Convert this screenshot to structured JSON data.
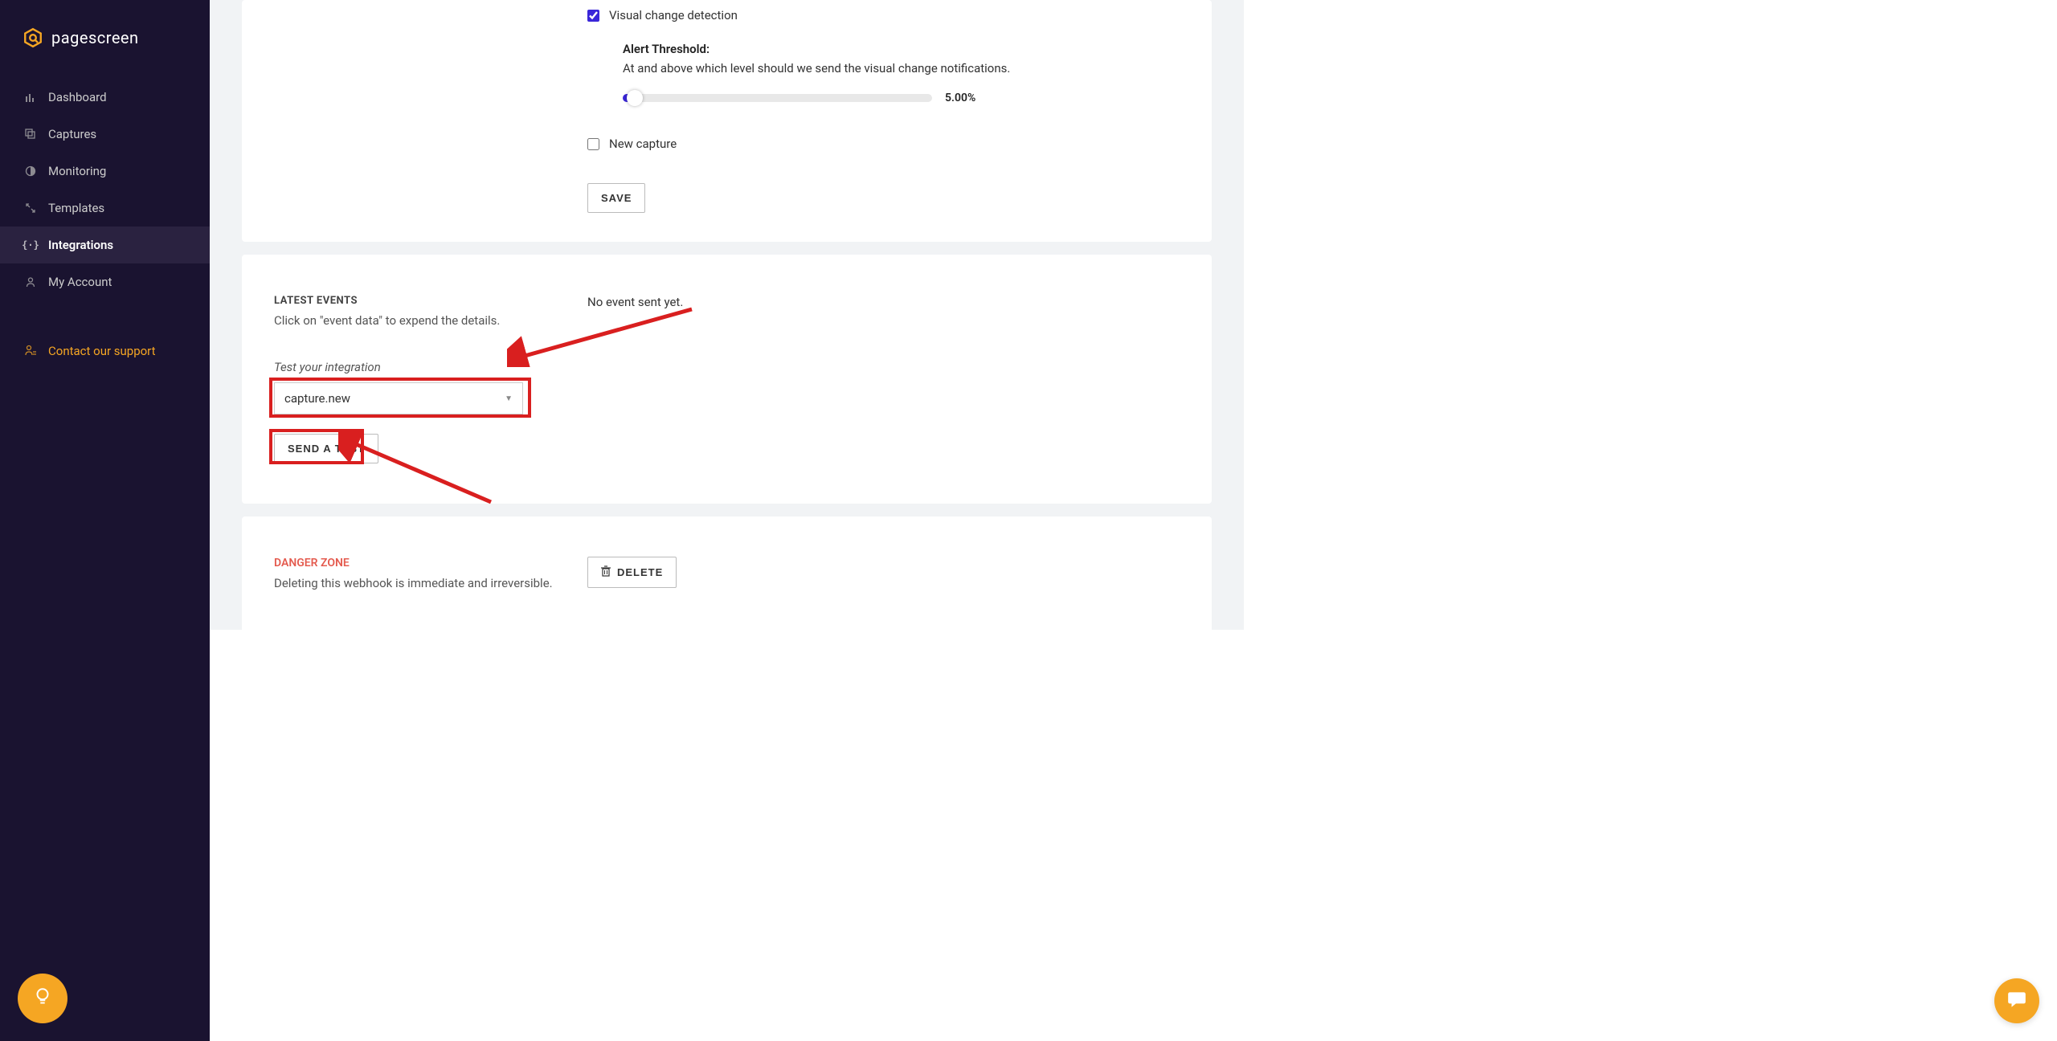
{
  "brand": {
    "name": "pagescreen"
  },
  "sidebar": {
    "items": [
      {
        "label": "Dashboard",
        "icon": "bars-icon"
      },
      {
        "label": "Captures",
        "icon": "stack-icon"
      },
      {
        "label": "Monitoring",
        "icon": "globe-icon"
      },
      {
        "label": "Templates",
        "icon": "expand-icon"
      },
      {
        "label": "Integrations",
        "icon": "braces-icon"
      },
      {
        "label": "My Account",
        "icon": "user-icon"
      }
    ],
    "support": {
      "label": "Contact our support"
    }
  },
  "settings": {
    "visual_change_label": "Visual change detection",
    "threshold": {
      "title": "Alert Threshold:",
      "desc": "At and above which level should we send the visual change notifications.",
      "value": "5.00%"
    },
    "new_capture_label": "New capture",
    "save_label": "SAVE"
  },
  "events": {
    "title": "LATEST EVENTS",
    "sub": "Click on \"event data\" to expend the details.",
    "empty": "No event sent yet.",
    "test_label": "Test your integration",
    "select_value": "capture.new",
    "send_label": "SEND A TEST"
  },
  "danger": {
    "title": "DANGER ZONE",
    "desc": "Deleting this webhook is immediate and irreversible.",
    "delete_label": "DELETE"
  }
}
